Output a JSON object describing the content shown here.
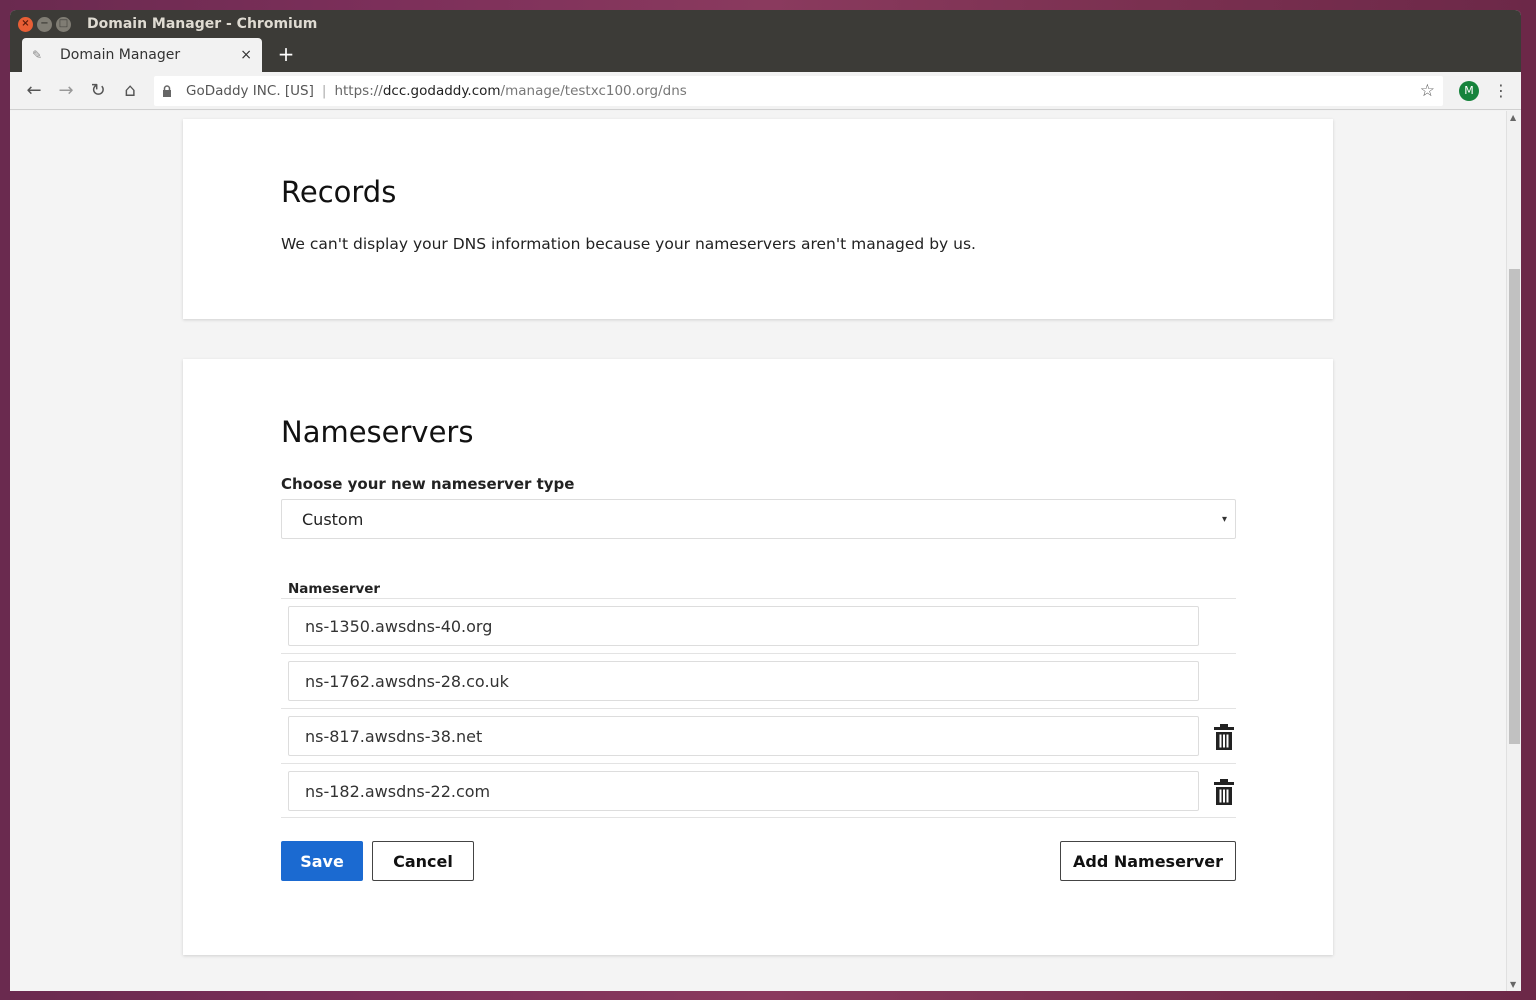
{
  "window": {
    "title": "Domain Manager - Chromium",
    "controls": {
      "close": "×",
      "minimize": "−",
      "maximize": "□"
    }
  },
  "tab": {
    "title": "Domain Manager",
    "favicon": "✎",
    "close": "×"
  },
  "newtab_label": "+",
  "toolbar": {
    "back": "←",
    "forward": "→",
    "reload": "↻",
    "home": "⌂",
    "org": "GoDaddy INC. [US]",
    "sep": "|",
    "url_scheme": "https://",
    "url_host": "dcc.godaddy.com",
    "url_path": "/manage/testxc100.org/dns",
    "star": "☆",
    "avatar": "M",
    "menu": "⋮"
  },
  "records": {
    "title": "Records",
    "desc": "We can't display your DNS information because your nameservers aren't managed by us."
  },
  "nameservers": {
    "title": "Nameservers",
    "choose_label": "Choose your new nameserver type",
    "select_value": "Custom",
    "select_caret": "▾",
    "column_header": "Nameserver",
    "rows": [
      {
        "value": "ns-1350.awsdns-40.org",
        "deletable": false
      },
      {
        "value": "ns-1762.awsdns-28.co.uk",
        "deletable": false
      },
      {
        "value": "ns-817.awsdns-38.net",
        "deletable": true
      },
      {
        "value": "ns-182.awsdns-22.com",
        "deletable": true
      }
    ],
    "save_label": "Save",
    "cancel_label": "Cancel",
    "add_label": "Add Nameserver"
  },
  "colors": {
    "primary": "#1b6ad1",
    "avatar": "#16833c"
  }
}
